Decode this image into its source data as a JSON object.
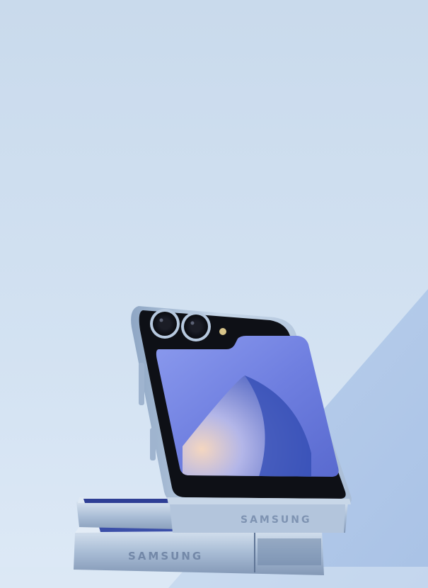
{
  "product": {
    "brand_top": "SAMSUNG",
    "brand_bottom": "SAMSUNG"
  },
  "colors": {
    "background_top": "#cbdcee",
    "background_bottom": "#dbe8f5",
    "accent_triangle": "#b7cde9",
    "phone_frame": "#b9cce3",
    "phone_frame_dark": "#7f97b6",
    "cover_screen_black": "#0e1016",
    "wallpaper_purple": "#7a86e8",
    "wallpaper_blue": "#3a52b8",
    "wallpaper_peach": "#f0c9b0"
  },
  "icons": [
    "camera-lens-icon",
    "flash-icon"
  ]
}
